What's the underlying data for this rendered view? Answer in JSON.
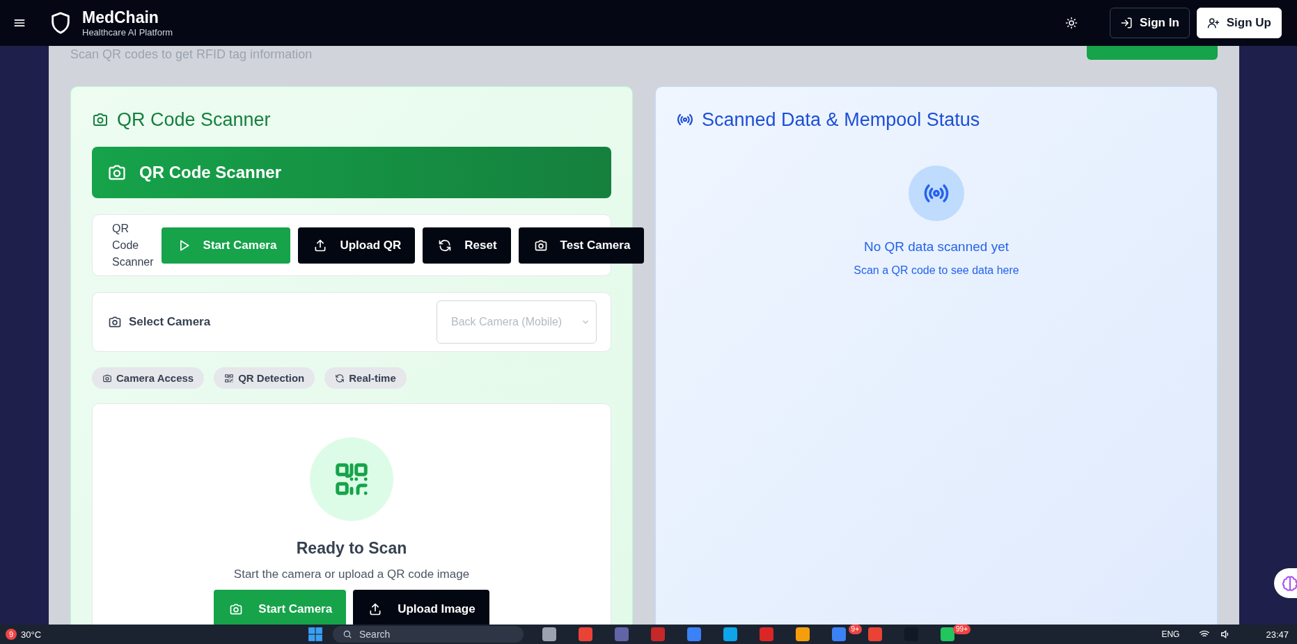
{
  "header": {
    "brand": {
      "name": "MedChain",
      "tagline": "Healthcare AI Platform"
    },
    "actions": [
      {
        "label": "Sign In",
        "kind": "signin"
      },
      {
        "label": "Sign Up",
        "kind": "signup"
      }
    ]
  },
  "page": {
    "subtitle": "Scan QR codes to get RFID tag information"
  },
  "scanner": {
    "title": "QR Code Scanner",
    "banner_title": "QR Code Scanner",
    "control_label": "QR Code Scanner",
    "buttons": [
      {
        "label": "Start Camera",
        "kind": "play"
      },
      {
        "label": "Upload QR",
        "kind": "upload"
      },
      {
        "label": "Reset",
        "kind": "reset"
      },
      {
        "label": "Test Camera",
        "kind": "camera"
      }
    ],
    "select_camera": {
      "label": "Select Camera",
      "value": "Back Camera (Mobile)",
      "disabled": true
    },
    "tags": [
      {
        "label": "Camera Access",
        "kind": "camera"
      },
      {
        "label": "QR Detection",
        "kind": "qr"
      },
      {
        "label": "Real-time",
        "kind": "reset"
      }
    ],
    "ready": {
      "title": "Ready to Scan",
      "text": "Start the camera or upload a QR code image",
      "buttons": [
        {
          "label": "Start Camera",
          "kind": "camera"
        },
        {
          "label": "Upload Image",
          "kind": "upload"
        }
      ]
    }
  },
  "status": {
    "title": "Scanned Data & Mempool Status",
    "empty_title": "No QR data scanned yet",
    "empty_text": "Scan a QR code to see data here"
  },
  "taskbar": {
    "weather": {
      "badge": "9",
      "temperature": "30°C"
    },
    "search": {
      "placeholder": "Search"
    },
    "apps": [
      {
        "color": "#9ca3af"
      },
      {
        "color": "#ea4335"
      },
      {
        "color": "#6264a7"
      },
      {
        "color": "#c62828"
      },
      {
        "color": "#3b82f6"
      },
      {
        "color": "#0ea5e9"
      },
      {
        "color": "#dc2626"
      },
      {
        "color": "#f59e0b"
      },
      {
        "color": "#3b82f6",
        "badge": "9+"
      },
      {
        "color": "#ea4335"
      },
      {
        "color": "#111827"
      },
      {
        "color": "#22c55e",
        "badge": "99+"
      }
    ],
    "language": "ENG",
    "time": "23:47"
  }
}
